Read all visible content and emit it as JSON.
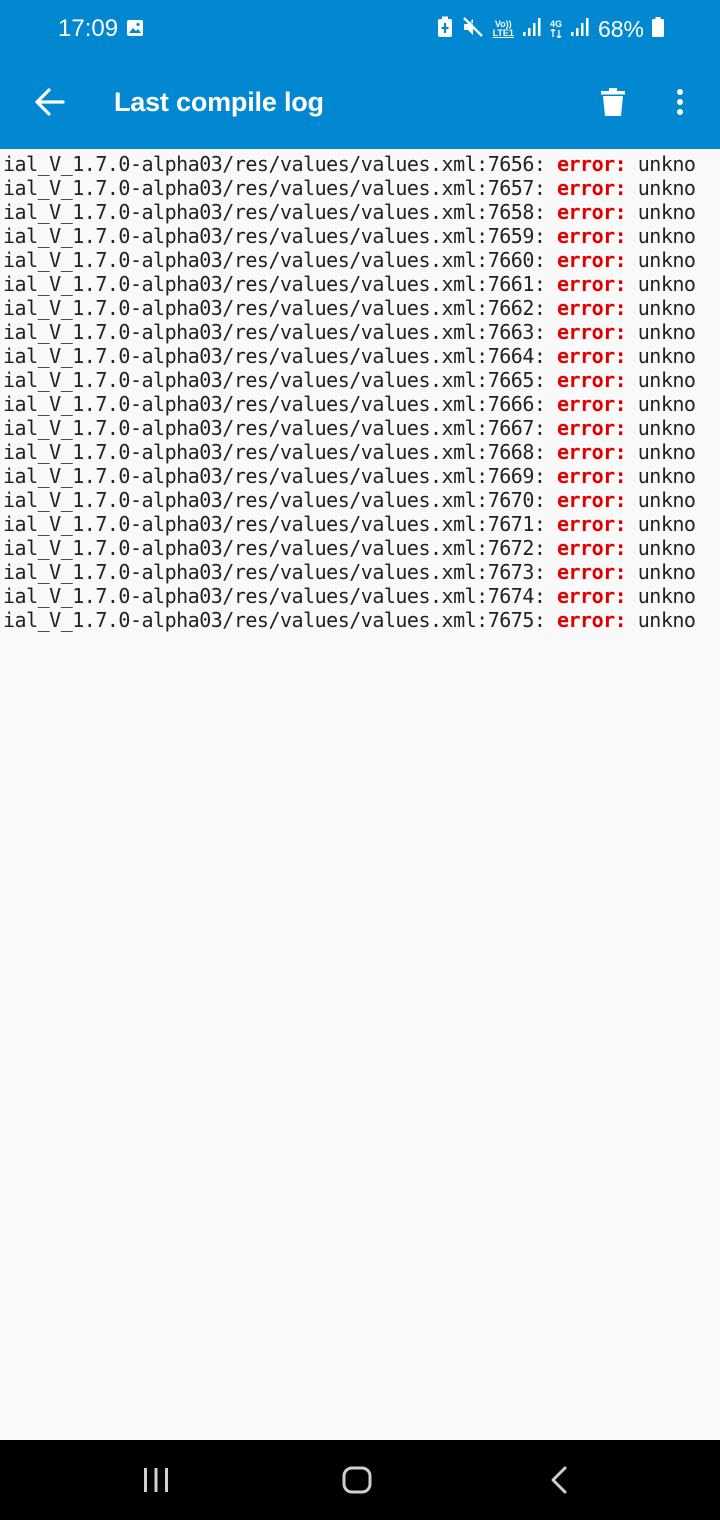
{
  "status_bar": {
    "time": "17:09",
    "battery_percent": "68%",
    "network_small_top": "Vo))",
    "network_small_bottom": "LTE1",
    "network_4g": "4G",
    "icons": [
      "gallery-icon",
      "battery-saver-icon",
      "mute-icon",
      "volte-icon",
      "signal-icon",
      "4g-icon",
      "signal-icon",
      "battery-icon"
    ],
    "color": "#0288d1"
  },
  "app_bar": {
    "title": "Last compile log",
    "back_icon": "arrow-back-icon",
    "delete_icon": "trash-icon",
    "more_icon": "more-vertical-icon",
    "color": "#0288d1"
  },
  "log": {
    "error_color": "#e00000",
    "lines": [
      {
        "prefix": "ial_V_1.7.0-alpha03/res/values/values.xml:7656: ",
        "level": "error:",
        "suffix": " unkno"
      },
      {
        "prefix": "ial_V_1.7.0-alpha03/res/values/values.xml:7657: ",
        "level": "error:",
        "suffix": " unkno"
      },
      {
        "prefix": "ial_V_1.7.0-alpha03/res/values/values.xml:7658: ",
        "level": "error:",
        "suffix": " unkno"
      },
      {
        "prefix": "ial_V_1.7.0-alpha03/res/values/values.xml:7659: ",
        "level": "error:",
        "suffix": " unkno"
      },
      {
        "prefix": "ial_V_1.7.0-alpha03/res/values/values.xml:7660: ",
        "level": "error:",
        "suffix": " unkno"
      },
      {
        "prefix": "ial_V_1.7.0-alpha03/res/values/values.xml:7661: ",
        "level": "error:",
        "suffix": " unkno"
      },
      {
        "prefix": "ial_V_1.7.0-alpha03/res/values/values.xml:7662: ",
        "level": "error:",
        "suffix": " unkno"
      },
      {
        "prefix": "ial_V_1.7.0-alpha03/res/values/values.xml:7663: ",
        "level": "error:",
        "suffix": " unkno"
      },
      {
        "prefix": "ial_V_1.7.0-alpha03/res/values/values.xml:7664: ",
        "level": "error:",
        "suffix": " unkno"
      },
      {
        "prefix": "ial_V_1.7.0-alpha03/res/values/values.xml:7665: ",
        "level": "error:",
        "suffix": " unkno"
      },
      {
        "prefix": "ial_V_1.7.0-alpha03/res/values/values.xml:7666: ",
        "level": "error:",
        "suffix": " unkno"
      },
      {
        "prefix": "ial_V_1.7.0-alpha03/res/values/values.xml:7667: ",
        "level": "error:",
        "suffix": " unkno"
      },
      {
        "prefix": "ial_V_1.7.0-alpha03/res/values/values.xml:7668: ",
        "level": "error:",
        "suffix": " unkno"
      },
      {
        "prefix": "ial_V_1.7.0-alpha03/res/values/values.xml:7669: ",
        "level": "error:",
        "suffix": " unkno"
      },
      {
        "prefix": "ial_V_1.7.0-alpha03/res/values/values.xml:7670: ",
        "level": "error:",
        "suffix": " unkno"
      },
      {
        "prefix": "ial_V_1.7.0-alpha03/res/values/values.xml:7671: ",
        "level": "error:",
        "suffix": " unkno"
      },
      {
        "prefix": "ial_V_1.7.0-alpha03/res/values/values.xml:7672: ",
        "level": "error:",
        "suffix": " unkno"
      },
      {
        "prefix": "ial_V_1.7.0-alpha03/res/values/values.xml:7673: ",
        "level": "error:",
        "suffix": " unkno"
      },
      {
        "prefix": "ial_V_1.7.0-alpha03/res/values/values.xml:7674: ",
        "level": "error:",
        "suffix": " unkno"
      },
      {
        "prefix": "ial_V_1.7.0-alpha03/res/values/values.xml:7675: ",
        "level": "error:",
        "suffix": " unkno"
      }
    ]
  },
  "nav_bar": {
    "icons": [
      "recent-apps-icon",
      "home-icon",
      "back-icon"
    ]
  }
}
